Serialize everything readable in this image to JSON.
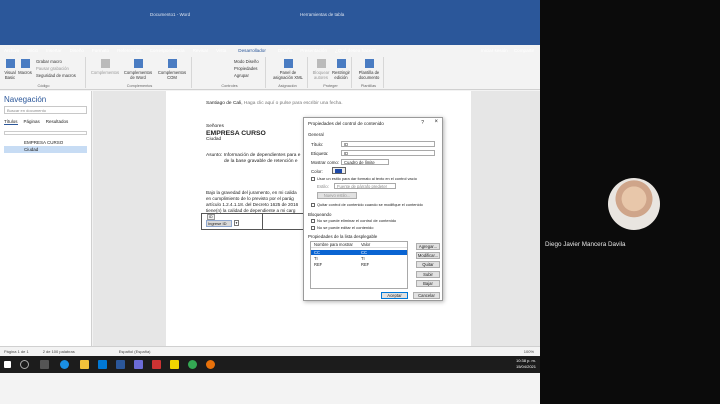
{
  "window": {
    "doc_title": "Documento1 - Word",
    "context_title": "Herramientas de tabla"
  },
  "ribbon_tabs": [
    "Archivo",
    "Inicio",
    "Insertar",
    "Diseño",
    "Formato",
    "Referencias",
    "Correspondencia",
    "Revisar",
    "Vista",
    "Desarrollador",
    "Diseño",
    "Presentación",
    "¿Qué desea hacer?"
  ],
  "ribbon_active_tab": "Desarrollador",
  "ribbon_right": {
    "signin": "Iniciar sesión",
    "share": "Compartir"
  },
  "ribbon": {
    "codigo": {
      "visual_basic": "Visual Basic",
      "macros": "Macros",
      "grabar_macro": "Grabar macro",
      "pausar": "Pausar grabación",
      "seguridad": "Seguridad de macros",
      "caption": "Código"
    },
    "complementos": {
      "c1": "Complementos",
      "c2": "Complementos de Word",
      "c3": "Complementos COM",
      "caption": "Complementos"
    },
    "controles": {
      "modo_diseno": "Modo Diseño",
      "propiedades": "Propiedades",
      "agrupar": "Agrupar",
      "caption": "Controles"
    },
    "asignacion": {
      "panel": "Panel de asignación XML",
      "caption": "Asignación"
    },
    "proteger": {
      "bloquear": "Bloquear autores",
      "restringir": "Restringir edición",
      "caption": "Proteger"
    },
    "plantillas": {
      "plantilla": "Plantilla de documento",
      "caption": "Plantillas"
    }
  },
  "nav": {
    "title": "Navegación",
    "search_placeholder": "Buscar en documento",
    "tabs": [
      "Títulos",
      "Páginas",
      "Resultados"
    ],
    "items": [
      "EMPRESA CURSO",
      "Ciudad"
    ],
    "selected_item": "Ciudad"
  },
  "document": {
    "date_line": "Santiago de Cali,",
    "date_placeholder": "Haga clic aquí o pulse para escribir una fecha.",
    "senores": "Señores",
    "empresa": "EMPRESA CURSO",
    "ciudad": "Ciudad",
    "asunto_label": "Asunto:",
    "asunto_text1": "Información de dependientes para e",
    "asunto_text2": "de la base gravable de retención e",
    "body1": "Bajo la gravedad del juramento, en mi calida",
    "body2": "en cumplimiento de lo previsto por el parág",
    "body3": "artículo 1.2.4.1.18. del Decreto 1625 de 2016",
    "body4": "tiene(n) la calidad de dependiente a mi carg",
    "table_cell_label": "ID",
    "table_cell": "Ingrese ID"
  },
  "dialog": {
    "title": "Propiedades del control de contenido",
    "help": "?",
    "close": "×",
    "general": "General",
    "titulo_label": "Título:",
    "titulo_value": "ID",
    "etiqueta_label": "Etiqueta:",
    "etiqueta_value": "ID",
    "mostrar_label": "Mostrar como:",
    "mostrar_value": "Cuadro de límite",
    "color_label": "Color:",
    "usar_estilo": "Usar un estilo para dar formato al texto en el control vacío",
    "estilo_label": "Estilo:",
    "estilo_value": "Fuente de párrafo predeter",
    "nuevo_estilo": "Nuevo estilo...",
    "quitar_control": "Quitar control de contenido cuando se modifique el contenido",
    "bloqueando": "Bloqueando",
    "no_eliminar": "No se puede eliminar el control de contenido",
    "no_editar": "No se puede editar el contenido",
    "propiedades_lista": "Propiedades de la lista desplegable",
    "col_nombre": "Nombre para mostrar",
    "col_valor": "Valor",
    "rows": [
      {
        "name": "CC",
        "value": "CC"
      },
      {
        "name": "TI",
        "value": "TI"
      },
      {
        "name": "REF",
        "value": "REF"
      }
    ],
    "btn_agregar": "Agregar...",
    "btn_modificar": "Modificar...",
    "btn_quitar": "Quitar",
    "btn_subir": "Subir",
    "btn_bajar": "Bajar",
    "btn_aceptar": "Aceptar",
    "btn_cancelar": "Cancelar",
    "color_value": "#1e4aa8"
  },
  "status": {
    "page": "Página 1 de 1",
    "words": "2 de 100 palabras",
    "language": "Español (España)",
    "zoom": "100%"
  },
  "taskbar": {
    "time": "10:38 p. m.",
    "date": "15/04/2021"
  },
  "participant": {
    "name": "Diego Javier Mancera Davila"
  }
}
